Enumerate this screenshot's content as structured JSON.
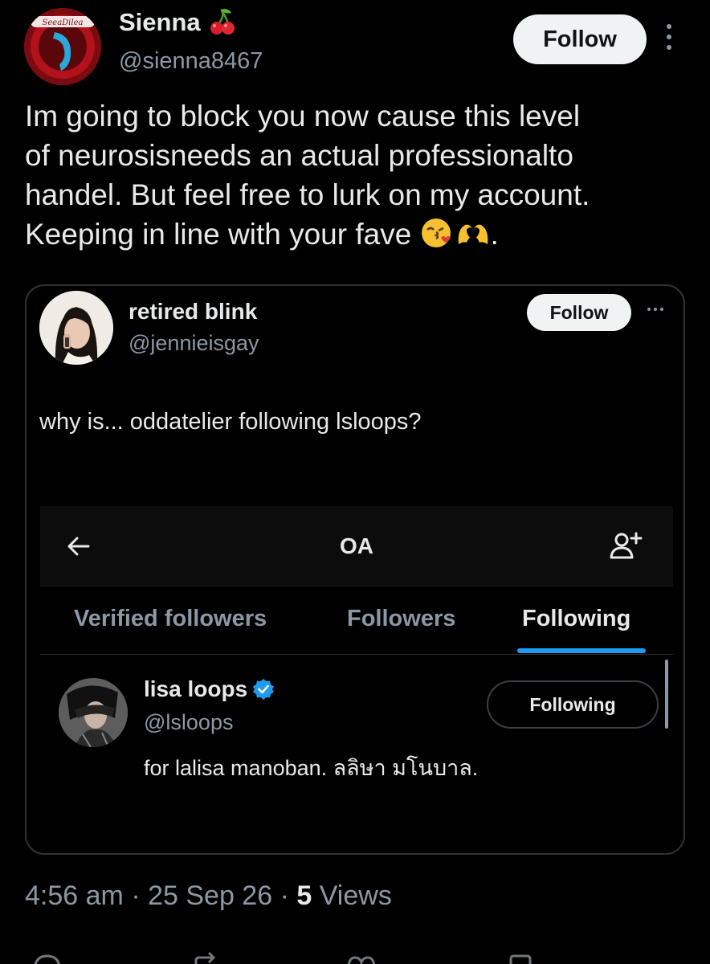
{
  "post": {
    "author_name": "Sienna",
    "author_name_emoji": "cherries-icon",
    "author_handle": "@sienna8467",
    "avatar_logo_text": "SeeaDilea",
    "follow_label": "Follow",
    "text_line_1": "Im going to block you now cause this level",
    "text_line_2": "of neurosisneeds an actual professionalto",
    "text_line_3": "handel. But feel free to lurk on my account.",
    "text_line_4_prefix": "Keeping in line with your fave ",
    "text_line_4_suffix": ".",
    "emojis": [
      "face-blowing-a-kiss-icon",
      "heart-hands-icon"
    ]
  },
  "quote": {
    "author_name": "retired blink",
    "author_handle": "@jennieisgay",
    "follow_label": "Follow",
    "text": "why is... oddatelier following lsloops?",
    "screenshot": {
      "title": "OA",
      "tabs": [
        {
          "label": "Verified followers",
          "active": false
        },
        {
          "label": "Followers",
          "active": false
        },
        {
          "label": "Following",
          "active": true
        }
      ],
      "user": {
        "name": "lisa loops",
        "handle": "@lsloops",
        "bio": "for lalisa manoban. ลลิษา มโนบาล.",
        "button_label": "Following",
        "verified": true
      }
    }
  },
  "footer": {
    "time": "4:56 am",
    "separator": "·",
    "date": "25 Sep 26",
    "views_count": "5",
    "views_label": "Views"
  },
  "colors": {
    "background": "#000000",
    "text_primary": "#e7e9ea",
    "text_secondary": "#8b98a5",
    "accent": "#1d9bf0",
    "border": "#2f3336"
  }
}
